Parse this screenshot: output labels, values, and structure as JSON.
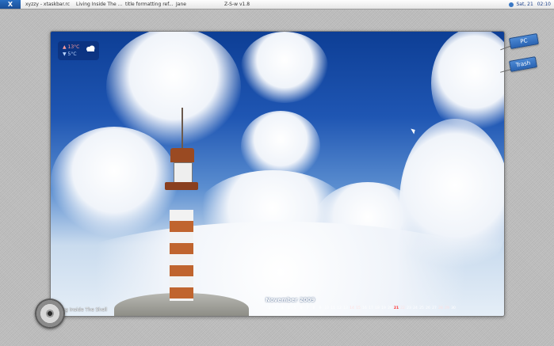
{
  "taskbar": {
    "start_label": "X",
    "tasks": [
      "xyzzy - xtaskbar.rc",
      "Living Inside The ...",
      "title formatting ref...",
      "Jane",
      "Z-S-w v1.8"
    ],
    "clock_date": "Sat, 21",
    "clock_time": "02:10"
  },
  "weather": {
    "high": "13°C",
    "low": "5°C"
  },
  "desktop_tags": {
    "pc": "PC",
    "trash": "Trash"
  },
  "wallpaper": {
    "footer_title": "Living Inside The Shell",
    "month": "November 2009",
    "days": [
      "1",
      "2",
      "3",
      "4",
      "5",
      "6",
      "7",
      "8",
      "9",
      "10",
      "11",
      "12",
      "13",
      "14",
      "15",
      "16",
      "17",
      "18",
      "19",
      "20",
      "21",
      "22",
      "23",
      "24",
      "25",
      "26",
      "27",
      "28",
      "29",
      "30"
    ],
    "today": "21"
  },
  "colors": {
    "accent": "#2a64b3",
    "sky": "#1f56b3",
    "today": "#ff3030"
  }
}
